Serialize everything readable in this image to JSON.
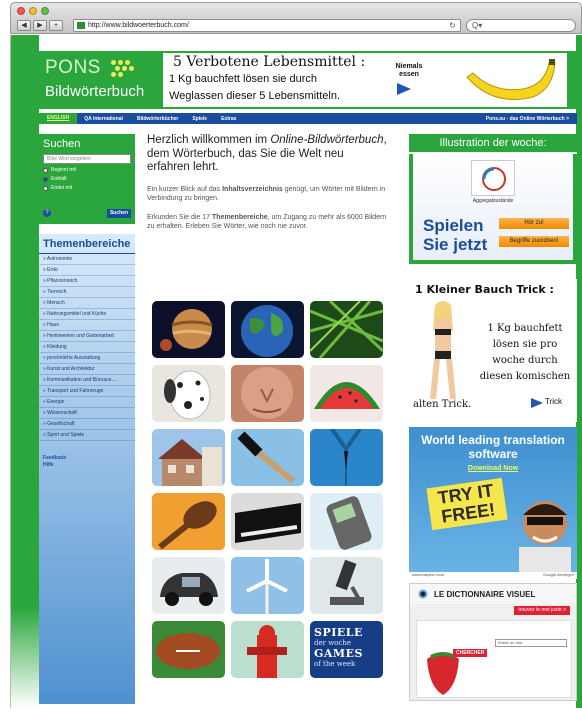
{
  "browser": {
    "url": "http://www.bildwoerterbuch.com/",
    "search_placeholder": "Q▾",
    "reload_icon": "↻"
  },
  "header": {
    "logo_pons": "PONS",
    "logo_bw": "Bildwörterbuch"
  },
  "top_ad": {
    "title": "5 Verbotene Lebensmittel :",
    "line1": "1 Kg bauchfett lösen sie durch",
    "line2": "Weglassen dieser 5 Lebensmitteln.",
    "niemals": "Niemals essen"
  },
  "topnav": {
    "english": "ENGLISH",
    "items": [
      "QA International",
      "Bildwörterbücher",
      "Spiele",
      "Extras"
    ],
    "right": "Pons.eu - das Online Wörterbuch >"
  },
  "search": {
    "title": "Suchen",
    "placeholder": "Bitte Wort eingeben",
    "options": [
      "Beginnt mit",
      "Enthält",
      "Endet mit"
    ],
    "help": "?",
    "button": "Suchen"
  },
  "themen": {
    "title": "Themenbereiche",
    "items": [
      "Astronomie",
      "Erde",
      "Pflanzenreich",
      "Tierreich",
      "Mensch",
      "Nahrungsmittel und Küche",
      "Haus",
      "Heimwerken und Gartenarbeit",
      "Kleidung",
      "persönliche Ausstattung",
      "Kunst und Architektur",
      "Kommunikation und Büroaus…",
      "Transport und Fahrzeuge",
      "Energie",
      "Wissenschaft",
      "Gesellschaft",
      "Sport und Spiele"
    ]
  },
  "side_links": [
    "Feedback",
    "Hilfe"
  ],
  "main": {
    "intro_a": "Herzlich willkommen im ",
    "intro_em": "Online-Bildwörterbuch",
    "intro_b": ", dem Wörterbuch, das Sie die Welt neu erfahren lehrt.",
    "p2_a": "Ein kurzer Blick auf das ",
    "p2_b": "Inhaltsverzeichnis",
    "p2_c": " genügt, um Wörter mit Bildern in Verbindung zu bringen.",
    "p3_a": "Erkunden Sie die 17 ",
    "p3_b": "Themenbereiche",
    "p3_c": ", um Zugang zu mehr als 6000 Bildern zu erhalten. Erleben Sie Wörter, wie noch nie zuvor."
  },
  "tiles": {
    "spiele_de": "SPIELE",
    "spiele_sub": "der woche",
    "games": "GAMES",
    "games_sub": "of the week"
  },
  "illustration": {
    "title": "Illustration der woche:",
    "caption": "Aggregatzustände",
    "spielen": "Spielen",
    "sie_jetzt": "Sie jetzt",
    "hoer": "Hör zu!",
    "begriffe": "Begriffe zuordnen!"
  },
  "belly_ad": {
    "title": "1 Kleiner Bauch Trick :",
    "text": "1 Kg bauchfett lösen sie pro woche durch diesen komischen",
    "last": "alten Trick.",
    "trick": "Trick"
  },
  "translate_ad": {
    "title": "World leading translation software",
    "download": "Download Now",
    "free": "TRY IT FREE!",
    "foot_left": "www.babylon.com",
    "foot_right": "Google-Anzeigen"
  },
  "dict_ad": {
    "title": "LE DICTIONNAIRE VISUEL",
    "button": "trouvez le mot juste >",
    "cherch": "CHERCHER",
    "input": "Entrer un mot"
  },
  "colors": {
    "brand_green": "#2aa63c",
    "nav_blue": "#1a4d9c",
    "accent_orange": "#ef8b00"
  }
}
